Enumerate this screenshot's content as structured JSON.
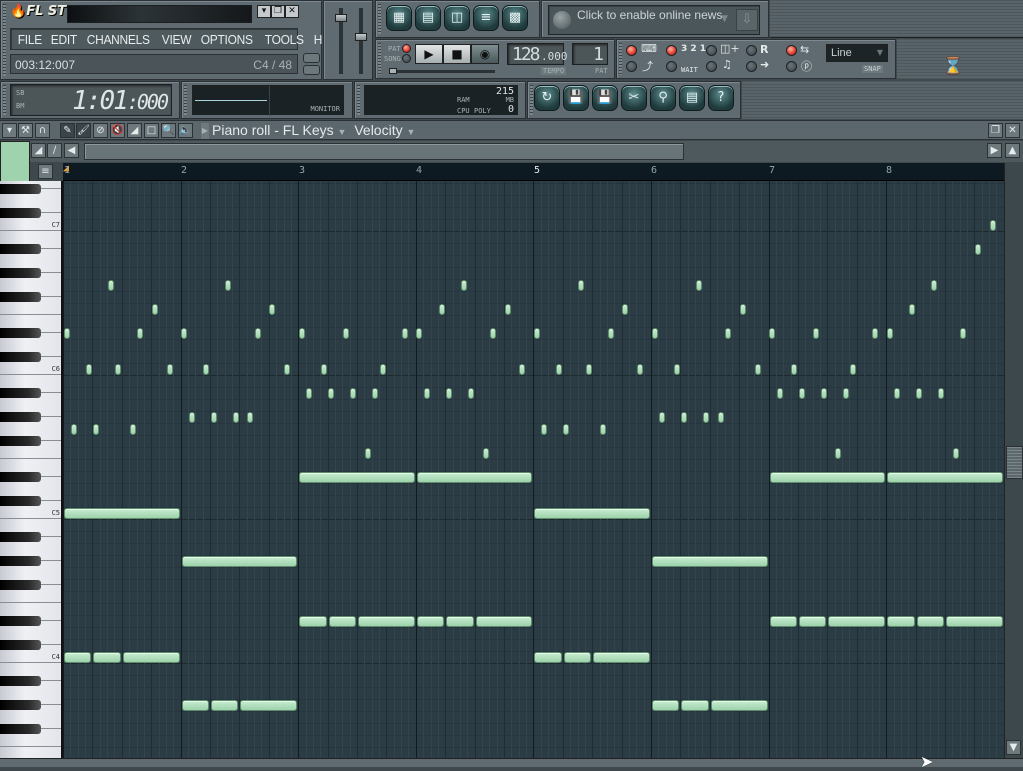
{
  "app": {
    "title": "FL STUDIO",
    "window_buttons": [
      "minimize",
      "restore",
      "close"
    ]
  },
  "menu": [
    "FILE",
    "EDIT",
    "CHANNELS",
    "VIEW",
    "OPTIONS",
    "TOOLS",
    "HELP"
  ],
  "hint_bar": {
    "text": "003:12:007",
    "note": "C4 / 48"
  },
  "time_display": {
    "main": "1:01",
    "ticks": ":000",
    "labels": [
      "SB",
      "BM"
    ]
  },
  "monitor": {
    "label": "MONITOR"
  },
  "cpu_panel": {
    "ram_label": "RAM",
    "mb_label": "MB",
    "mb_value": "215",
    "cpu_label": "CPU",
    "poly_label": "POLY",
    "poly_value": "0"
  },
  "window_shortcuts": [
    "playlist-icon",
    "step-sequencer-icon",
    "piano-roll-icon",
    "browser-icon",
    "mixer-icon"
  ],
  "news": {
    "text": "Click to enable online news"
  },
  "transport": {
    "pat_label": "PAT",
    "song_label": "SONG",
    "mode": "PAT",
    "tempo": "128",
    "tempo_decimals": ".000",
    "tempo_label": "TEMPO",
    "pattern": "1",
    "pattern_label": "PAT"
  },
  "recording_options": [
    {
      "name": "typing-keyboard",
      "on": true
    },
    {
      "name": "metronome",
      "on": false
    },
    {
      "name": "countdown",
      "label": "3 2 1",
      "on": true
    },
    {
      "name": "wait-for-input",
      "label": "WAIT",
      "on": false
    },
    {
      "name": "step-edit",
      "on": false
    },
    {
      "name": "blend-notes",
      "on": false
    },
    {
      "name": "loop-record",
      "label": "R",
      "on": false
    },
    {
      "name": "scroll",
      "on": false
    },
    {
      "name": "multilink",
      "on": true
    },
    {
      "name": "joystick",
      "on": false
    }
  ],
  "snap": {
    "value": "Line",
    "label": "SNAP"
  },
  "tool_buttons": [
    "undo-icon",
    "save-new-icon",
    "save-as-icon",
    "cut-icon",
    "record-audio-icon",
    "project-info-icon",
    "help-icon"
  ],
  "piano_roll": {
    "title": "Piano roll - FL Keys",
    "target": "Velocity",
    "ruler_bars": [
      "1",
      "2",
      "3",
      "4",
      "5",
      "6",
      "7",
      "8"
    ],
    "key_labels": [
      "C7",
      "C6",
      "C5",
      "C4"
    ],
    "note_color": "#a8dab4",
    "grid_color": "#2c3c45",
    "notes": [
      {
        "step": 0,
        "len": 16,
        "pitch": "C5"
      },
      {
        "step": 0,
        "len": 4,
        "pitch": "C4"
      },
      {
        "step": 4,
        "len": 4,
        "pitch": "C4"
      },
      {
        "step": 8,
        "len": 8,
        "pitch": "C4"
      },
      {
        "step": 16,
        "len": 16,
        "pitch": "G#4"
      },
      {
        "step": 16,
        "len": 4,
        "pitch": "G#3"
      },
      {
        "step": 20,
        "len": 4,
        "pitch": "G#3"
      },
      {
        "step": 24,
        "len": 8,
        "pitch": "G#3"
      },
      {
        "step": 32,
        "len": 16,
        "pitch": "D#5"
      },
      {
        "step": 48,
        "len": 16,
        "pitch": "D#5"
      },
      {
        "step": 32,
        "len": 4,
        "pitch": "D#4"
      },
      {
        "step": 36,
        "len": 4,
        "pitch": "D#4"
      },
      {
        "step": 40,
        "len": 8,
        "pitch": "D#4"
      },
      {
        "step": 48,
        "len": 4,
        "pitch": "D#4"
      },
      {
        "step": 52,
        "len": 4,
        "pitch": "D#4"
      },
      {
        "step": 56,
        "len": 8,
        "pitch": "D#4"
      },
      {
        "step": 64,
        "len": 16,
        "pitch": "C5"
      },
      {
        "step": 64,
        "len": 4,
        "pitch": "C4"
      },
      {
        "step": 68,
        "len": 4,
        "pitch": "C4"
      },
      {
        "step": 72,
        "len": 8,
        "pitch": "C4"
      },
      {
        "step": 80,
        "len": 16,
        "pitch": "G#4"
      },
      {
        "step": 80,
        "len": 4,
        "pitch": "G#3"
      },
      {
        "step": 84,
        "len": 4,
        "pitch": "G#3"
      },
      {
        "step": 88,
        "len": 8,
        "pitch": "G#3"
      },
      {
        "step": 96,
        "len": 16,
        "pitch": "D#5"
      },
      {
        "step": 112,
        "len": 16,
        "pitch": "D#5"
      },
      {
        "step": 96,
        "len": 4,
        "pitch": "D#4"
      },
      {
        "step": 100,
        "len": 4,
        "pitch": "D#4"
      },
      {
        "step": 104,
        "len": 8,
        "pitch": "D#4"
      },
      {
        "step": 112,
        "len": 4,
        "pitch": "D#4"
      },
      {
        "step": 116,
        "len": 4,
        "pitch": "D#4"
      },
      {
        "step": 120,
        "len": 8,
        "pitch": "D#4"
      },
      {
        "step": 0,
        "len": 1,
        "pitch": "D#6"
      },
      {
        "step": 1,
        "len": 1,
        "pitch": "G5"
      },
      {
        "step": 3,
        "len": 1,
        "pitch": "C6"
      },
      {
        "step": 4,
        "len": 1,
        "pitch": "G5"
      },
      {
        "step": 6,
        "len": 1,
        "pitch": "G6"
      },
      {
        "step": 7,
        "len": 1,
        "pitch": "C6"
      },
      {
        "step": 9,
        "len": 1,
        "pitch": "G5"
      },
      {
        "step": 10,
        "len": 1,
        "pitch": "D#6"
      },
      {
        "step": 12,
        "len": 1,
        "pitch": "F6"
      },
      {
        "step": 14,
        "len": 1,
        "pitch": "C6"
      },
      {
        "step": 16,
        "len": 1,
        "pitch": "D#6"
      },
      {
        "step": 17,
        "len": 1,
        "pitch": "G#5"
      },
      {
        "step": 19,
        "len": 1,
        "pitch": "C6"
      },
      {
        "step": 20,
        "len": 1,
        "pitch": "G#5"
      },
      {
        "step": 22,
        "len": 1,
        "pitch": "G6"
      },
      {
        "step": 23,
        "len": 1,
        "pitch": "G#5"
      },
      {
        "step": 25,
        "len": 1,
        "pitch": "G#5"
      },
      {
        "step": 26,
        "len": 1,
        "pitch": "D#6"
      },
      {
        "step": 28,
        "len": 1,
        "pitch": "F6"
      },
      {
        "step": 30,
        "len": 1,
        "pitch": "C6"
      },
      {
        "step": 32,
        "len": 1,
        "pitch": "D#6"
      },
      {
        "step": 33,
        "len": 1,
        "pitch": "A#5"
      },
      {
        "step": 35,
        "len": 1,
        "pitch": "C6"
      },
      {
        "step": 36,
        "len": 1,
        "pitch": "A#5"
      },
      {
        "step": 38,
        "len": 1,
        "pitch": "D#6"
      },
      {
        "step": 39,
        "len": 1,
        "pitch": "A#5"
      },
      {
        "step": 41,
        "len": 1,
        "pitch": "F5"
      },
      {
        "step": 42,
        "len": 1,
        "pitch": "A#5"
      },
      {
        "step": 43,
        "len": 1,
        "pitch": "C6"
      },
      {
        "step": 46,
        "len": 1,
        "pitch": "D#6"
      },
      {
        "step": 48,
        "len": 1,
        "pitch": "D#6"
      },
      {
        "step": 49,
        "len": 1,
        "pitch": "A#5"
      },
      {
        "step": 51,
        "len": 1,
        "pitch": "F6"
      },
      {
        "step": 52,
        "len": 1,
        "pitch": "A#5"
      },
      {
        "step": 54,
        "len": 1,
        "pitch": "G6"
      },
      {
        "step": 55,
        "len": 1,
        "pitch": "A#5"
      },
      {
        "step": 57,
        "len": 1,
        "pitch": "F5"
      },
      {
        "step": 58,
        "len": 1,
        "pitch": "D#6"
      },
      {
        "step": 60,
        "len": 1,
        "pitch": "F6"
      },
      {
        "step": 62,
        "len": 1,
        "pitch": "C6"
      },
      {
        "step": 64,
        "len": 1,
        "pitch": "D#6"
      },
      {
        "step": 65,
        "len": 1,
        "pitch": "G5"
      },
      {
        "step": 67,
        "len": 1,
        "pitch": "C6"
      },
      {
        "step": 68,
        "len": 1,
        "pitch": "G5"
      },
      {
        "step": 70,
        "len": 1,
        "pitch": "G6"
      },
      {
        "step": 71,
        "len": 1,
        "pitch": "C6"
      },
      {
        "step": 73,
        "len": 1,
        "pitch": "G5"
      },
      {
        "step": 74,
        "len": 1,
        "pitch": "D#6"
      },
      {
        "step": 76,
        "len": 1,
        "pitch": "F6"
      },
      {
        "step": 78,
        "len": 1,
        "pitch": "C6"
      },
      {
        "step": 80,
        "len": 1,
        "pitch": "D#6"
      },
      {
        "step": 81,
        "len": 1,
        "pitch": "G#5"
      },
      {
        "step": 83,
        "len": 1,
        "pitch": "C6"
      },
      {
        "step": 84,
        "len": 1,
        "pitch": "G#5"
      },
      {
        "step": 86,
        "len": 1,
        "pitch": "G6"
      },
      {
        "step": 87,
        "len": 1,
        "pitch": "G#5"
      },
      {
        "step": 89,
        "len": 1,
        "pitch": "G#5"
      },
      {
        "step": 90,
        "len": 1,
        "pitch": "D#6"
      },
      {
        "step": 92,
        "len": 1,
        "pitch": "F6"
      },
      {
        "step": 94,
        "len": 1,
        "pitch": "C6"
      },
      {
        "step": 96,
        "len": 1,
        "pitch": "D#6"
      },
      {
        "step": 97,
        "len": 1,
        "pitch": "A#5"
      },
      {
        "step": 99,
        "len": 1,
        "pitch": "C6"
      },
      {
        "step": 100,
        "len": 1,
        "pitch": "A#5"
      },
      {
        "step": 102,
        "len": 1,
        "pitch": "D#6"
      },
      {
        "step": 103,
        "len": 1,
        "pitch": "A#5"
      },
      {
        "step": 105,
        "len": 1,
        "pitch": "F5"
      },
      {
        "step": 106,
        "len": 1,
        "pitch": "A#5"
      },
      {
        "step": 107,
        "len": 1,
        "pitch": "C6"
      },
      {
        "step": 110,
        "len": 1,
        "pitch": "D#6"
      },
      {
        "step": 112,
        "len": 1,
        "pitch": "D#6"
      },
      {
        "step": 113,
        "len": 1,
        "pitch": "A#5"
      },
      {
        "step": 115,
        "len": 1,
        "pitch": "F6"
      },
      {
        "step": 116,
        "len": 1,
        "pitch": "A#5"
      },
      {
        "step": 118,
        "len": 1,
        "pitch": "G6"
      },
      {
        "step": 119,
        "len": 1,
        "pitch": "A#5"
      },
      {
        "step": 121,
        "len": 1,
        "pitch": "F5"
      },
      {
        "step": 122,
        "len": 1,
        "pitch": "D#6"
      },
      {
        "step": 124,
        "len": 1,
        "pitch": "A#6"
      },
      {
        "step": 126,
        "len": 1,
        "pitch": "C7"
      }
    ]
  }
}
